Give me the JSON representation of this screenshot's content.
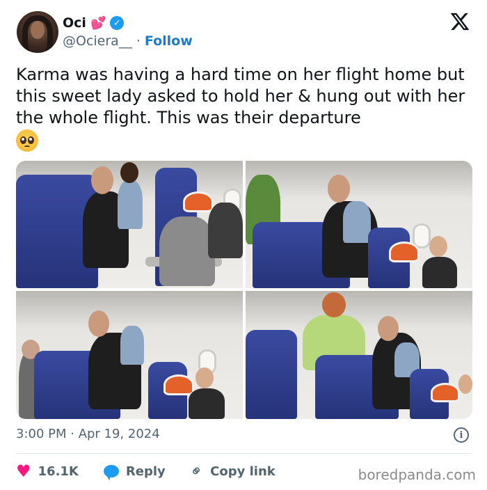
{
  "author": {
    "display_name": "Oci",
    "name_emoji": "💕",
    "handle": "@Ociera__",
    "separator": "·",
    "follow_label": "Follow",
    "verified_mark": "✓"
  },
  "tweet": {
    "text": "Karma was having a hard time on her flight home but this sweet lady asked to hold her & hung out with her the whole flight. This was their departure",
    "trailing_emoji": "pleading-face-emoji",
    "photos": [
      "airplane-cabin-photo",
      "airplane-cabin-photo",
      "airplane-cabin-photo",
      "airplane-cabin-photo"
    ],
    "timestamp": "3:00 PM · Apr 19, 2024"
  },
  "actions": {
    "like_count": "16.1K",
    "reply_label": "Reply",
    "copy_link_label": "Copy link"
  },
  "icons": {
    "close": "x-logo-icon",
    "info": "info-icon",
    "like": "heart-icon",
    "reply": "reply-bubble-icon",
    "link": "link-icon"
  },
  "colors": {
    "accent": "#1d9bf0",
    "like": "#f91880",
    "muted": "#536471",
    "seat_blue": "#2c3a8c"
  },
  "watermark": "boredpanda.com"
}
